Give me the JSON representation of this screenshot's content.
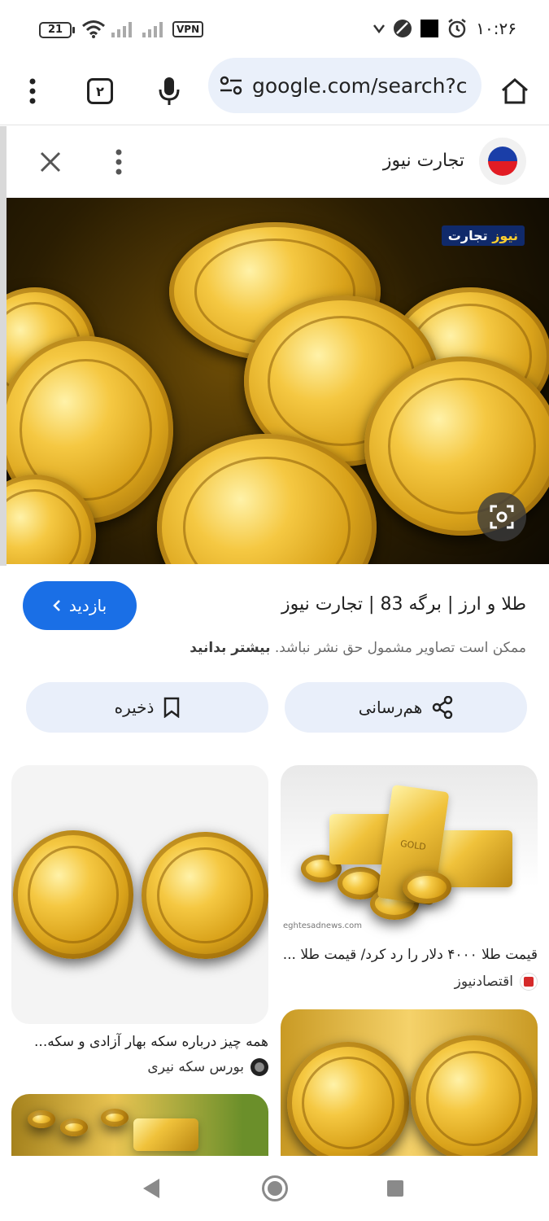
{
  "status_bar": {
    "battery": "21",
    "vpn": "VPN",
    "time": "۱۰:۲۶"
  },
  "toolbar": {
    "tab_count": "۲",
    "url": "google.com/search?c"
  },
  "panel": {
    "site_name": "تجارت نیوز",
    "watermark_a": "تجارت",
    "watermark_b": "نیوز"
  },
  "details": {
    "visit_label": "بازدید",
    "title": "طلا و ارز | برگه 83 | تجارت نیوز",
    "copyright_text": "ممکن است تصاویر مشمول حق نشر نباشد.",
    "learn_more": "بیشتر بدانید",
    "share_label": "هم‌رسانی",
    "save_label": "ذخیره"
  },
  "related": [
    {
      "caption": "قیمت طلا ۴۰۰۰ دلار را رد کرد/ قیمت طلا ...",
      "source": "اقتصادنیوز",
      "site_text": "eghtesadnews.com",
      "bar_text": "GOLD"
    },
    {
      "caption": "همه چیز درباره سکه بهار آزادی و سکه...",
      "source": "بورس سکه نیری"
    }
  ],
  "colors": {
    "accent": "#1a6fe6",
    "pill_bg": "#e9effa",
    "omnibox_bg": "#eaf0fa"
  }
}
